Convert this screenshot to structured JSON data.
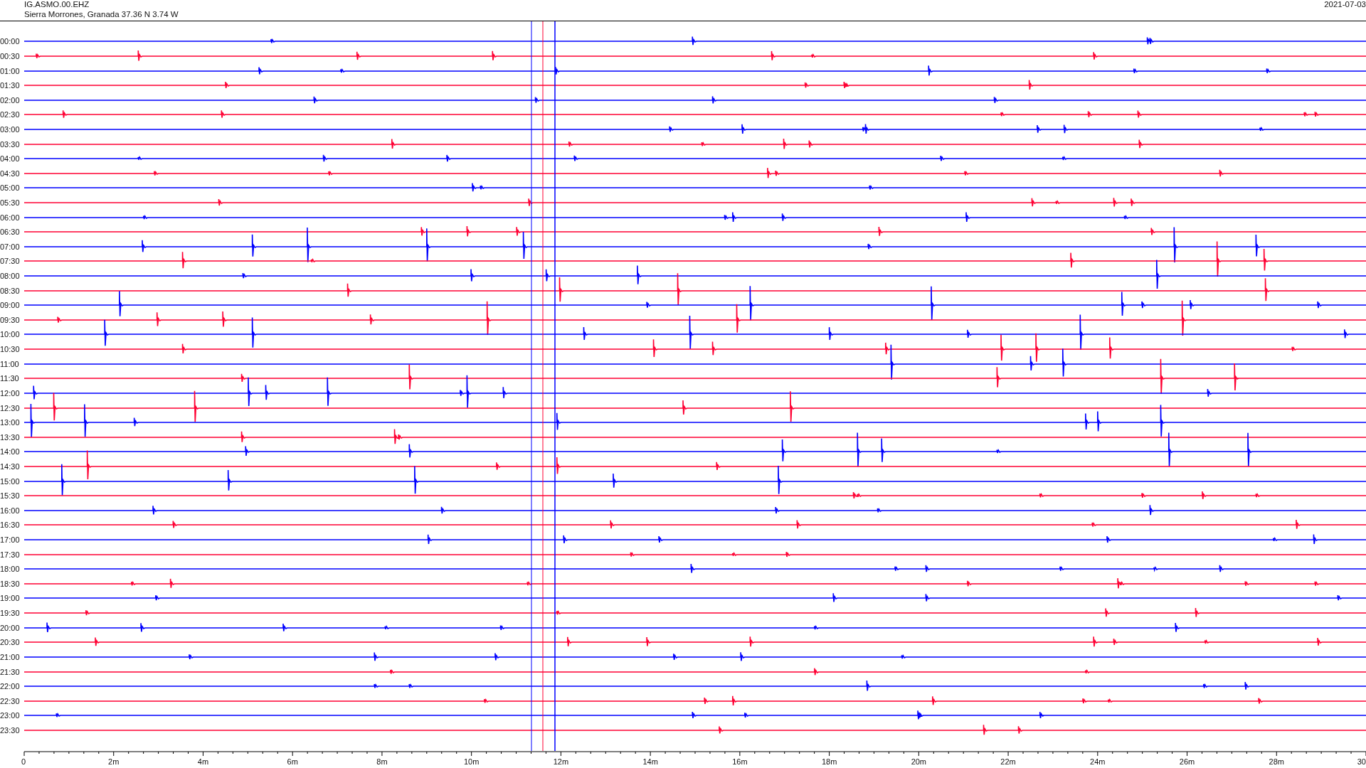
{
  "header": {
    "station": "IG.ASMO.00.EHZ",
    "location": "Sierra Morrones, Granada  37.36 N 3.74 W",
    "date": "2021-07-03"
  },
  "rows": [
    {
      "time": "00:00",
      "color": "#0000ff"
    },
    {
      "time": "00:30",
      "color": "#ff0033"
    },
    {
      "time": "01:00",
      "color": "#0000ff"
    },
    {
      "time": "01:30",
      "color": "#ff0033"
    },
    {
      "time": "02:00",
      "color": "#0000ff"
    },
    {
      "time": "02:30",
      "color": "#ff0033"
    },
    {
      "time": "03:00",
      "color": "#0000ff"
    },
    {
      "time": "03:30",
      "color": "#ff0033"
    },
    {
      "time": "04:00",
      "color": "#0000ff"
    },
    {
      "time": "04:30",
      "color": "#ff0033"
    },
    {
      "time": "05:00",
      "color": "#0000ff"
    },
    {
      "time": "05:30",
      "color": "#ff0033"
    },
    {
      "time": "06:00",
      "color": "#0000ff"
    },
    {
      "time": "06:30",
      "color": "#ff0033"
    },
    {
      "time": "07:00",
      "color": "#0000ff"
    },
    {
      "time": "07:30",
      "color": "#ff0033"
    },
    {
      "time": "08:00",
      "color": "#0000ff"
    },
    {
      "time": "08:30",
      "color": "#ff0033"
    },
    {
      "time": "09:00",
      "color": "#0000ff"
    },
    {
      "time": "09:30",
      "color": "#ff0033"
    },
    {
      "time": "10:00",
      "color": "#0000ff"
    },
    {
      "time": "10:30",
      "color": "#ff0033"
    },
    {
      "time": "11:00",
      "color": "#0000ff"
    },
    {
      "time": "11:30",
      "color": "#ff0033"
    },
    {
      "time": "12:00",
      "color": "#0000ff"
    },
    {
      "time": "12:30",
      "color": "#ff0033"
    },
    {
      "time": "13:00",
      "color": "#0000ff"
    },
    {
      "time": "13:30",
      "color": "#ff0033"
    },
    {
      "time": "14:00",
      "color": "#0000ff"
    },
    {
      "time": "14:30",
      "color": "#ff0033"
    },
    {
      "time": "15:00",
      "color": "#0000ff"
    },
    {
      "time": "15:30",
      "color": "#ff0033"
    },
    {
      "time": "16:00",
      "color": "#0000ff"
    },
    {
      "time": "16:30",
      "color": "#ff0033"
    },
    {
      "time": "17:00",
      "color": "#0000ff"
    },
    {
      "time": "17:30",
      "color": "#ff0033"
    },
    {
      "time": "18:00",
      "color": "#0000ff"
    },
    {
      "time": "18:30",
      "color": "#ff0033"
    },
    {
      "time": "19:00",
      "color": "#0000ff"
    },
    {
      "time": "19:30",
      "color": "#ff0033"
    },
    {
      "time": "20:00",
      "color": "#0000ff"
    },
    {
      "time": "20:30",
      "color": "#ff0033"
    },
    {
      "time": "21:00",
      "color": "#0000ff"
    },
    {
      "time": "21:30",
      "color": "#ff0033"
    },
    {
      "time": "22:00",
      "color": "#0000ff"
    },
    {
      "time": "22:30",
      "color": "#ff0033"
    },
    {
      "time": "23:00",
      "color": "#0000ff"
    },
    {
      "time": "23:30",
      "color": "#ff0033"
    }
  ],
  "axis": {
    "ticks": [
      "0",
      "2m",
      "4m",
      "6m",
      "8m",
      "10m",
      "12m",
      "14m",
      "16m",
      "18m",
      "20m",
      "22m",
      "24m",
      "26m",
      "28m",
      "30"
    ]
  }
}
